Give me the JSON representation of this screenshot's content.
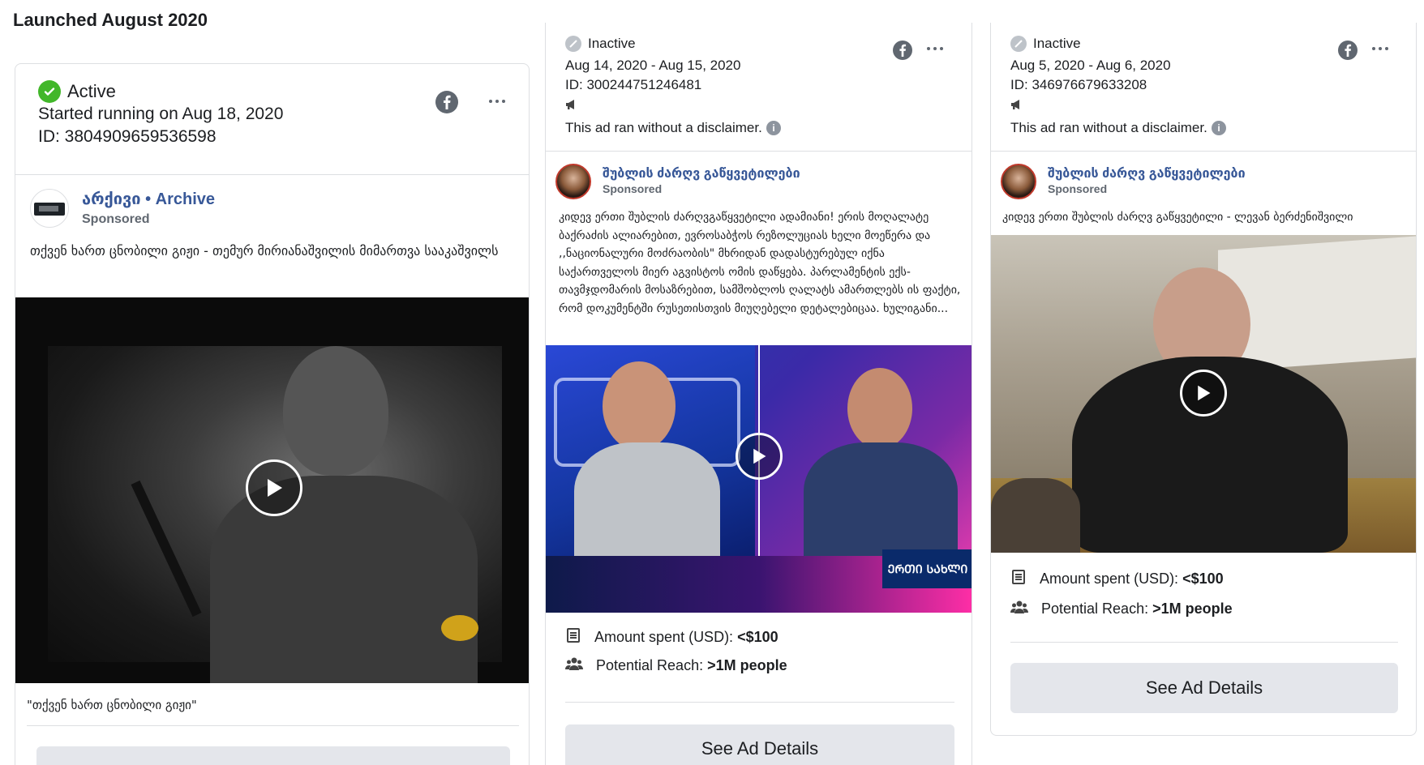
{
  "heading": "Launched August 2020",
  "cards": [
    {
      "status": "Active",
      "dates": "Started running on Aug 18, 2020",
      "id": "ID: 3804909659536598",
      "page_name": "არქივი • Archive",
      "sponsored": "Sponsored",
      "body": "თქვენ ხართ ცნობილი გიჟი - თემურ მირიანაშვილის მიმართვა სააკაშვილს",
      "caption": "\"თქვენ ხართ ცნობილი გიჟი\""
    },
    {
      "status": "Inactive",
      "dates": "Aug 14, 2020 - Aug 15, 2020",
      "id": "ID: 300244751246481",
      "disclaimer": "This ad ran without a disclaimer.",
      "page_name": "შუბლის ძარღვ გაწყვეტილები",
      "sponsored": "Sponsored",
      "body": "კიდევ ერთი შუბლის ძარღვგაწყვეტილი ადამიანი! ერის მოღალატე ბაქრაძის ალიარებით, ევროსაბჭოს რეზოლუციას ხელი მოეწერა და ,,ნაციონალური მოძრაობის\" მხრიდან დადასტურებულ იქნა საქართველოს მიერ აგვისტოს ომის დაწყება. პარლამენტის ექს-თავმჯდომარის მოსაზრებით, სამშობლოს ღალატს ამართლებს ის ფაქტი, რომ დოკუმენტში რუსეთისთვის მიუღებელი დეტალებიცაა. ხულიგანი...",
      "amount_label": "Amount spent (USD): ",
      "amount_value": "<$100",
      "reach_label": "Potential Reach: ",
      "reach_value": ">1M people",
      "button": "See Ad Details"
    },
    {
      "status": "Inactive",
      "dates": "Aug 5, 2020 - Aug 6, 2020",
      "id": "ID: 346976679633208",
      "disclaimer": "This ad ran without a disclaimer.",
      "page_name": "შუბლის ძარღვ გაწყვეტილები",
      "sponsored": "Sponsored",
      "body": "კიდევ ერთი შუბლის ძარღვ გაწყვეტილი - ლევან ბერძენიშვილი",
      "amount_label": "Amount spent (USD): ",
      "amount_value": "<$100",
      "reach_label": "Potential Reach: ",
      "reach_value": ">1M people",
      "button": "See Ad Details"
    }
  ],
  "studio_logo_text": "ᲔᲠᲗᲘ ᲡᲐᲮᲚᲘ"
}
